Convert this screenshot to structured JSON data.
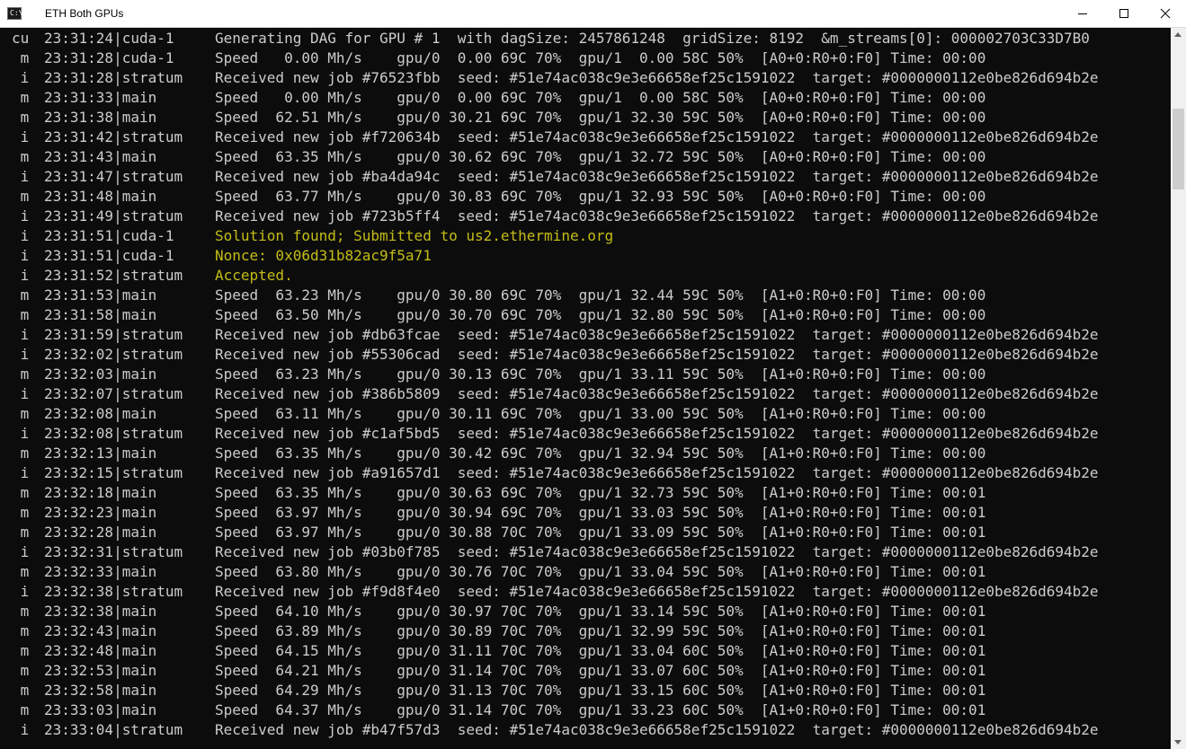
{
  "window": {
    "title": "ETH Both GPUs",
    "icon_text": "C:\\",
    "icon": "cmd-icon",
    "buttons": [
      "minimize-icon",
      "maximize-icon",
      "close-icon"
    ]
  },
  "colors": {
    "background": "#0c0c0c",
    "text": "#cccccc",
    "highlight": "#c4bd16"
  },
  "console": {
    "lines": [
      {
        "tag": "cu",
        "time": "23:31:24|cuda-1",
        "msg": "Generating DAG for GPU # 1  with dagSize: 2457861248  gridSize: 8192  &m_streams[0]: 000002703C33D7B0",
        "hl": false
      },
      {
        "tag": " m",
        "time": "23:31:28|cuda-1",
        "msg": "Speed   0.00 Mh/s    gpu/0  0.00 69C 70%  gpu/1  0.00 58C 50%  [A0+0:R0+0:F0] Time: 00:00",
        "hl": false
      },
      {
        "tag": " i",
        "time": "23:31:28|stratum",
        "msg": "Received new job #76523fbb  seed: #51e74ac038c9e3e66658ef25c1591022  target: #0000000112e0be826d694b2e",
        "hl": false
      },
      {
        "tag": " m",
        "time": "23:31:33|main",
        "msg": "Speed   0.00 Mh/s    gpu/0  0.00 69C 70%  gpu/1  0.00 58C 50%  [A0+0:R0+0:F0] Time: 00:00",
        "hl": false
      },
      {
        "tag": " m",
        "time": "23:31:38|main",
        "msg": "Speed  62.51 Mh/s    gpu/0 30.21 69C 70%  gpu/1 32.30 59C 50%  [A0+0:R0+0:F0] Time: 00:00",
        "hl": false
      },
      {
        "tag": " i",
        "time": "23:31:42|stratum",
        "msg": "Received new job #f720634b  seed: #51e74ac038c9e3e66658ef25c1591022  target: #0000000112e0be826d694b2e",
        "hl": false
      },
      {
        "tag": " m",
        "time": "23:31:43|main",
        "msg": "Speed  63.35 Mh/s    gpu/0 30.62 69C 70%  gpu/1 32.72 59C 50%  [A0+0:R0+0:F0] Time: 00:00",
        "hl": false
      },
      {
        "tag": " i",
        "time": "23:31:47|stratum",
        "msg": "Received new job #ba4da94c  seed: #51e74ac038c9e3e66658ef25c1591022  target: #0000000112e0be826d694b2e",
        "hl": false
      },
      {
        "tag": " m",
        "time": "23:31:48|main",
        "msg": "Speed  63.77 Mh/s    gpu/0 30.83 69C 70%  gpu/1 32.93 59C 50%  [A0+0:R0+0:F0] Time: 00:00",
        "hl": false
      },
      {
        "tag": " i",
        "time": "23:31:49|stratum",
        "msg": "Received new job #723b5ff4  seed: #51e74ac038c9e3e66658ef25c1591022  target: #0000000112e0be826d694b2e",
        "hl": false
      },
      {
        "tag": " i",
        "time": "23:31:51|cuda-1",
        "msg": "Solution found; Submitted to us2.ethermine.org",
        "hl": true
      },
      {
        "tag": " i",
        "time": "23:31:51|cuda-1",
        "msg": "Nonce: 0x06d31b82ac9f5a71",
        "hl": true
      },
      {
        "tag": " i",
        "time": "23:31:52|stratum",
        "msg": "Accepted.",
        "hl": true
      },
      {
        "tag": " m",
        "time": "23:31:53|main",
        "msg": "Speed  63.23 Mh/s    gpu/0 30.80 69C 70%  gpu/1 32.44 59C 50%  [A1+0:R0+0:F0] Time: 00:00",
        "hl": false
      },
      {
        "tag": " m",
        "time": "23:31:58|main",
        "msg": "Speed  63.50 Mh/s    gpu/0 30.70 69C 70%  gpu/1 32.80 59C 50%  [A1+0:R0+0:F0] Time: 00:00",
        "hl": false
      },
      {
        "tag": " i",
        "time": "23:31:59|stratum",
        "msg": "Received new job #db63fcae  seed: #51e74ac038c9e3e66658ef25c1591022  target: #0000000112e0be826d694b2e",
        "hl": false
      },
      {
        "tag": " i",
        "time": "23:32:02|stratum",
        "msg": "Received new job #55306cad  seed: #51e74ac038c9e3e66658ef25c1591022  target: #0000000112e0be826d694b2e",
        "hl": false
      },
      {
        "tag": " m",
        "time": "23:32:03|main",
        "msg": "Speed  63.23 Mh/s    gpu/0 30.13 69C 70%  gpu/1 33.11 59C 50%  [A1+0:R0+0:F0] Time: 00:00",
        "hl": false
      },
      {
        "tag": " i",
        "time": "23:32:07|stratum",
        "msg": "Received new job #386b5809  seed: #51e74ac038c9e3e66658ef25c1591022  target: #0000000112e0be826d694b2e",
        "hl": false
      },
      {
        "tag": " m",
        "time": "23:32:08|main",
        "msg": "Speed  63.11 Mh/s    gpu/0 30.11 69C 70%  gpu/1 33.00 59C 50%  [A1+0:R0+0:F0] Time: 00:00",
        "hl": false
      },
      {
        "tag": " i",
        "time": "23:32:08|stratum",
        "msg": "Received new job #c1af5bd5  seed: #51e74ac038c9e3e66658ef25c1591022  target: #0000000112e0be826d694b2e",
        "hl": false
      },
      {
        "tag": " m",
        "time": "23:32:13|main",
        "msg": "Speed  63.35 Mh/s    gpu/0 30.42 69C 70%  gpu/1 32.94 59C 50%  [A1+0:R0+0:F0] Time: 00:00",
        "hl": false
      },
      {
        "tag": " i",
        "time": "23:32:15|stratum",
        "msg": "Received new job #a91657d1  seed: #51e74ac038c9e3e66658ef25c1591022  target: #0000000112e0be826d694b2e",
        "hl": false
      },
      {
        "tag": " m",
        "time": "23:32:18|main",
        "msg": "Speed  63.35 Mh/s    gpu/0 30.63 69C 70%  gpu/1 32.73 59C 50%  [A1+0:R0+0:F0] Time: 00:01",
        "hl": false
      },
      {
        "tag": " m",
        "time": "23:32:23|main",
        "msg": "Speed  63.97 Mh/s    gpu/0 30.94 69C 70%  gpu/1 33.03 59C 50%  [A1+0:R0+0:F0] Time: 00:01",
        "hl": false
      },
      {
        "tag": " m",
        "time": "23:32:28|main",
        "msg": "Speed  63.97 Mh/s    gpu/0 30.88 70C 70%  gpu/1 33.09 59C 50%  [A1+0:R0+0:F0] Time: 00:01",
        "hl": false
      },
      {
        "tag": " i",
        "time": "23:32:31|stratum",
        "msg": "Received new job #03b0f785  seed: #51e74ac038c9e3e66658ef25c1591022  target: #0000000112e0be826d694b2e",
        "hl": false
      },
      {
        "tag": " m",
        "time": "23:32:33|main",
        "msg": "Speed  63.80 Mh/s    gpu/0 30.76 70C 70%  gpu/1 33.04 59C 50%  [A1+0:R0+0:F0] Time: 00:01",
        "hl": false
      },
      {
        "tag": " i",
        "time": "23:32:38|stratum",
        "msg": "Received new job #f9d8f4e0  seed: #51e74ac038c9e3e66658ef25c1591022  target: #0000000112e0be826d694b2e",
        "hl": false
      },
      {
        "tag": " m",
        "time": "23:32:38|main",
        "msg": "Speed  64.10 Mh/s    gpu/0 30.97 70C 70%  gpu/1 33.14 59C 50%  [A1+0:R0+0:F0] Time: 00:01",
        "hl": false
      },
      {
        "tag": " m",
        "time": "23:32:43|main",
        "msg": "Speed  63.89 Mh/s    gpu/0 30.89 70C 70%  gpu/1 32.99 59C 50%  [A1+0:R0+0:F0] Time: 00:01",
        "hl": false
      },
      {
        "tag": " m",
        "time": "23:32:48|main",
        "msg": "Speed  64.15 Mh/s    gpu/0 31.11 70C 70%  gpu/1 33.04 60C 50%  [A1+0:R0+0:F0] Time: 00:01",
        "hl": false
      },
      {
        "tag": " m",
        "time": "23:32:53|main",
        "msg": "Speed  64.21 Mh/s    gpu/0 31.14 70C 70%  gpu/1 33.07 60C 50%  [A1+0:R0+0:F0] Time: 00:01",
        "hl": false
      },
      {
        "tag": " m",
        "time": "23:32:58|main",
        "msg": "Speed  64.29 Mh/s    gpu/0 31.13 70C 70%  gpu/1 33.15 60C 50%  [A1+0:R0+0:F0] Time: 00:01",
        "hl": false
      },
      {
        "tag": " m",
        "time": "23:33:03|main",
        "msg": "Speed  64.37 Mh/s    gpu/0 31.14 70C 70%  gpu/1 33.23 60C 50%  [A1+0:R0+0:F0] Time: 00:01",
        "hl": false
      },
      {
        "tag": " i",
        "time": "23:33:04|stratum",
        "msg": "Received new job #b47f57d3  seed: #51e74ac038c9e3e66658ef25c1591022  target: #0000000112e0be826d694b2e",
        "hl": false
      }
    ]
  }
}
